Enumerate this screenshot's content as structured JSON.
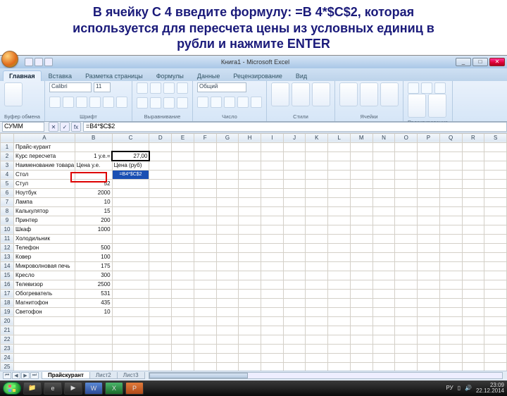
{
  "caption": {
    "line1": "В ячейку С 4 введите формулу: =B 4*$C$2, которая",
    "line2": "используется для пересчета цены из условных единиц в",
    "line3": "рубли и нажмите ENTER"
  },
  "titlebar": {
    "title": "Книга1 - Microsoft Excel"
  },
  "win_buttons": {
    "min": "_",
    "max": "□",
    "close": "✕"
  },
  "ribbon": {
    "tabs": [
      "Главная",
      "Вставка",
      "Разметка страницы",
      "Формулы",
      "Данные",
      "Рецензирование",
      "Вид"
    ],
    "active": 0,
    "font_name": "Calibri",
    "font_size": "11",
    "groups": {
      "clipboard": "Буфер обмена",
      "font": "Шрифт",
      "alignment": "Выравнивание",
      "number": "Число",
      "number_format": "Общий",
      "styles": "Стили",
      "cells": "Ячейки",
      "editing": "Редактирование"
    }
  },
  "fx": {
    "name_box": "СУММ",
    "x": "✕",
    "check": "✓",
    "fx": "fx",
    "formula": "=B4*$C$2"
  },
  "columns": [
    "",
    "A",
    "B",
    "C",
    "D",
    "E",
    "F",
    "G",
    "H",
    "I",
    "J",
    "K",
    "L",
    "M",
    "N",
    "O",
    "P",
    "Q",
    "R",
    "S"
  ],
  "rows": [
    {
      "n": "1",
      "a": "Прайс-курант",
      "b": "",
      "c": ""
    },
    {
      "n": "2",
      "a": "Курс пересчета",
      "b": "1 у.е.=",
      "c": "27,00"
    },
    {
      "n": "3",
      "a": "Наименование товара",
      "b": "Цена у.е.",
      "c": "Цена (руб)"
    },
    {
      "n": "4",
      "a": "Стол",
      "b": "",
      "c": "=B4*$C$2"
    },
    {
      "n": "5",
      "a": "Стул",
      "b": "52",
      "c": ""
    },
    {
      "n": "6",
      "a": "Ноутбук",
      "b": "2000",
      "c": ""
    },
    {
      "n": "7",
      "a": "Лампа",
      "b": "10",
      "c": ""
    },
    {
      "n": "8",
      "a": "Калькулятор",
      "b": "15",
      "c": ""
    },
    {
      "n": "9",
      "a": "Принтер",
      "b": "200",
      "c": ""
    },
    {
      "n": "10",
      "a": "Шкаф",
      "b": "1000",
      "c": ""
    },
    {
      "n": "11",
      "a": "Холодильник",
      "b": "",
      "c": ""
    },
    {
      "n": "12",
      "a": "Телефон",
      "b": "500",
      "c": ""
    },
    {
      "n": "13",
      "a": "Ковер",
      "b": "100",
      "c": ""
    },
    {
      "n": "14",
      "a": "Микроволновая печь",
      "b": "175",
      "c": ""
    },
    {
      "n": "15",
      "a": "Кресло",
      "b": "300",
      "c": ""
    },
    {
      "n": "16",
      "a": "Телевизор",
      "b": "2500",
      "c": ""
    },
    {
      "n": "17",
      "a": "Обогреватель",
      "b": "531",
      "c": ""
    },
    {
      "n": "18",
      "a": "Магнитофон",
      "b": "435",
      "c": ""
    },
    {
      "n": "19",
      "a": "Светофон",
      "b": "10",
      "c": ""
    },
    {
      "n": "20",
      "a": "",
      "b": "",
      "c": ""
    },
    {
      "n": "21",
      "a": "",
      "b": "",
      "c": ""
    },
    {
      "n": "22",
      "a": "",
      "b": "",
      "c": ""
    },
    {
      "n": "23",
      "a": "",
      "b": "",
      "c": ""
    },
    {
      "n": "24",
      "a": "",
      "b": "",
      "c": ""
    },
    {
      "n": "25",
      "a": "",
      "b": "",
      "c": ""
    }
  ],
  "sheets": {
    "active": "Прайскурант",
    "s2": "Лист2",
    "s3": "Лист3"
  },
  "tray": {
    "lang": "РУ",
    "time": "23:09",
    "date": "22.12.2014"
  },
  "icons": {
    "qa": [
      "save",
      "undo",
      "redo"
    ],
    "taskbar_items": [
      "folder",
      "browser",
      "media",
      "word",
      "excel",
      "ppt"
    ]
  }
}
